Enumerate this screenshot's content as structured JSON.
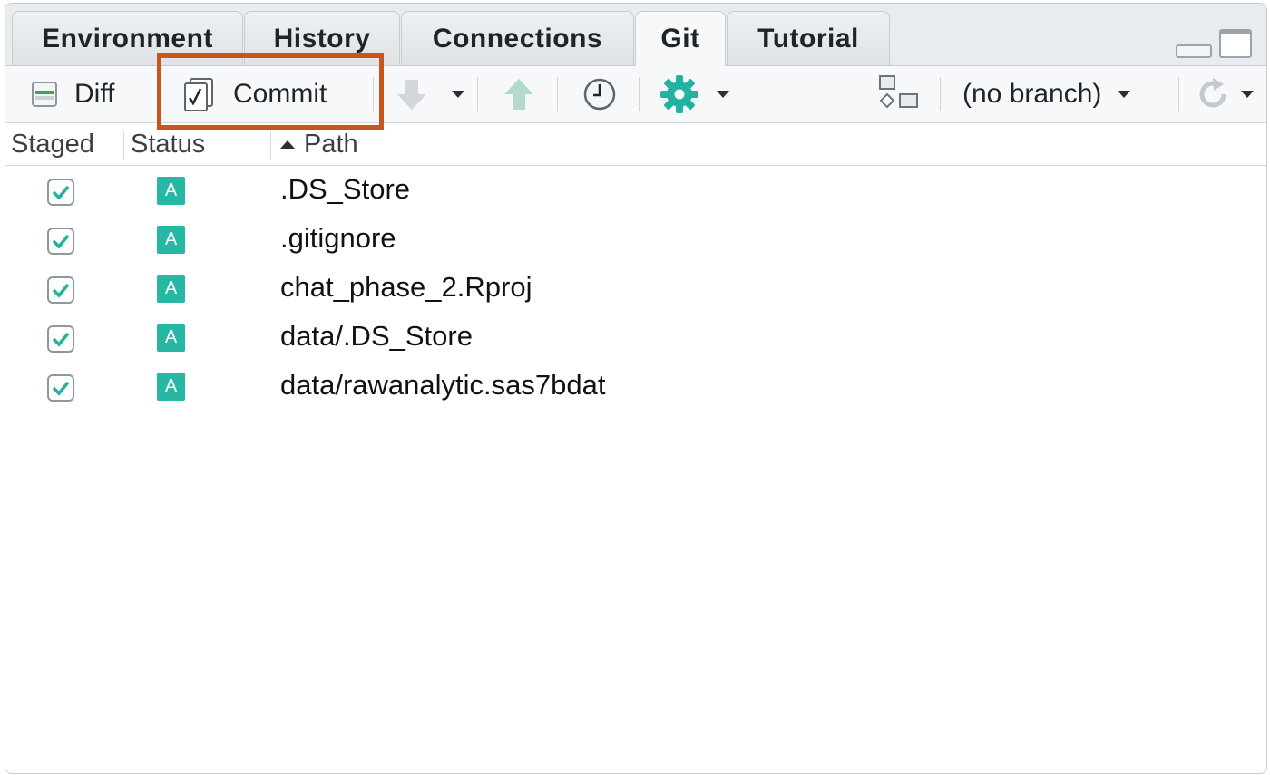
{
  "tabs": [
    {
      "label": "Environment"
    },
    {
      "label": "History"
    },
    {
      "label": "Connections"
    },
    {
      "label": "Git"
    },
    {
      "label": "Tutorial"
    }
  ],
  "active_tab": "Git",
  "toolbar": {
    "diff_label": "Diff",
    "commit_label": "Commit",
    "pull_icon": "down-arrow-icon",
    "push_icon": "up-arrow-icon",
    "history_icon": "clock-icon",
    "more_icon": "gear-icon",
    "new_branch_icon": "branch-icon",
    "branch_label": "(no branch)",
    "refresh_icon": "refresh-icon"
  },
  "columns": {
    "staged": "Staged",
    "status": "Status",
    "path": "Path"
  },
  "files": [
    {
      "staged": true,
      "status": "A",
      "path": ".DS_Store"
    },
    {
      "staged": true,
      "status": "A",
      "path": ".gitignore"
    },
    {
      "staged": true,
      "status": "A",
      "path": "chat_phase_2.Rproj"
    },
    {
      "staged": true,
      "status": "A",
      "path": "data/.DS_Store"
    },
    {
      "staged": true,
      "status": "A",
      "path": "data/rawanalytic.sas7bdat"
    }
  ],
  "colors": {
    "accent_teal": "#26b8a5",
    "highlight_box": "#c8561a"
  }
}
